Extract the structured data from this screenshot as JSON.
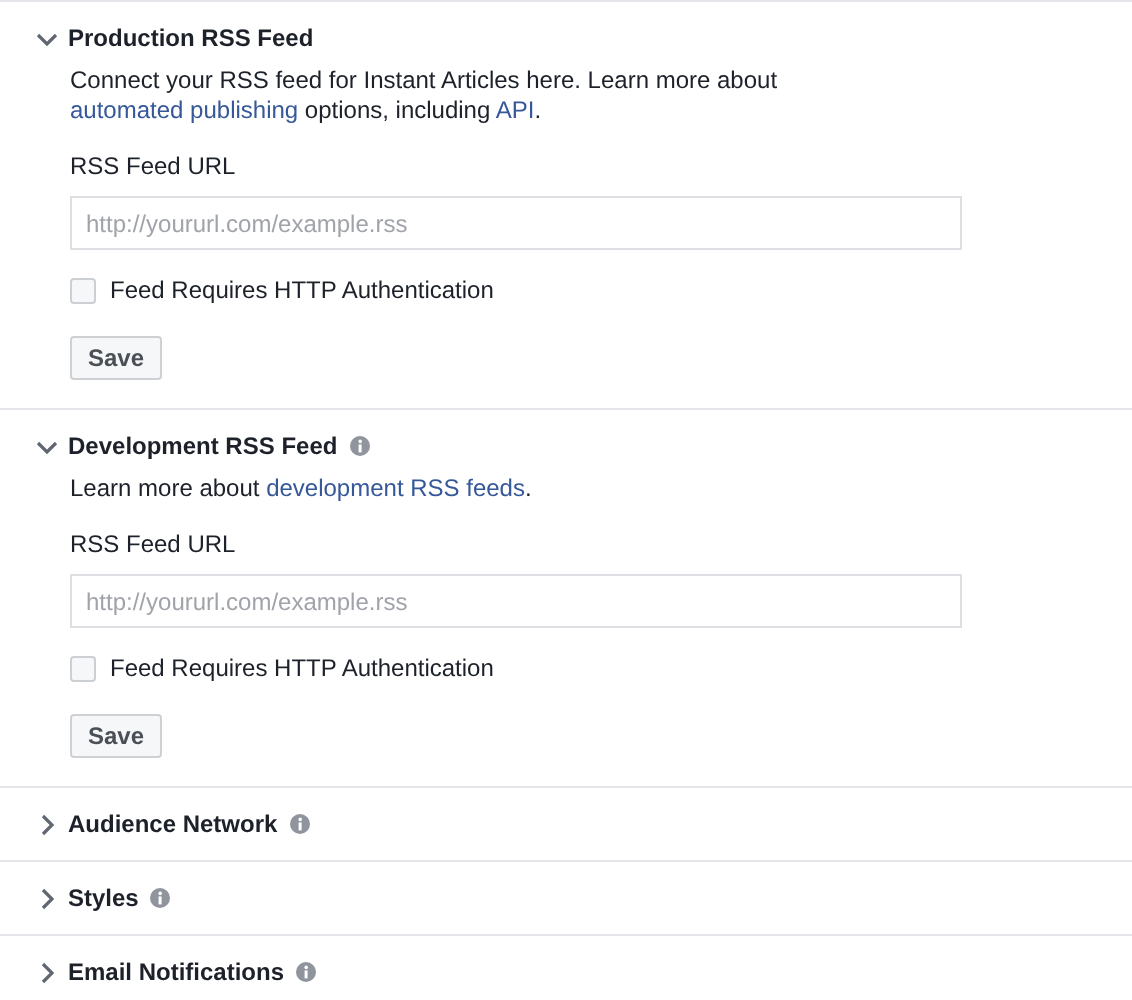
{
  "sections": [
    {
      "title": "Production RSS Feed",
      "expanded": true,
      "info": false,
      "description": [
        {
          "text": "Connect your RSS feed for Instant Articles here. Learn more about "
        },
        {
          "text": "automated publishing",
          "link": true
        },
        {
          "text": " options, including "
        },
        {
          "text": "API",
          "link": true
        },
        {
          "text": "."
        }
      ],
      "field_label": "RSS Feed URL",
      "placeholder": "http://yoururl.com/example.rss",
      "checkbox": {
        "label": "Feed Requires HTTP Authentication",
        "checked": false
      },
      "button": "Save"
    },
    {
      "title": "Development RSS Feed",
      "expanded": true,
      "info": true,
      "description": [
        {
          "text": "Learn more about "
        },
        {
          "text": "development RSS feeds",
          "link": true
        },
        {
          "text": "."
        }
      ],
      "field_label": "RSS Feed URL",
      "placeholder": "http://yoururl.com/example.rss",
      "checkbox": {
        "label": "Feed Requires HTTP Authentication",
        "checked": false
      },
      "button": "Save"
    },
    {
      "title": "Audience Network",
      "expanded": false,
      "info": true
    },
    {
      "title": "Styles",
      "expanded": false,
      "info": true
    },
    {
      "title": "Email Notifications",
      "expanded": false,
      "info": true
    }
  ]
}
